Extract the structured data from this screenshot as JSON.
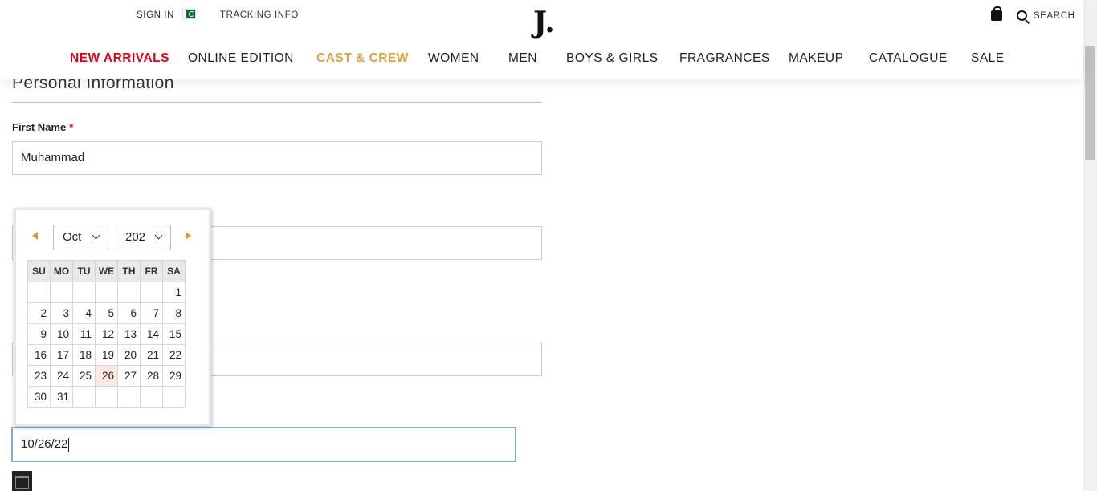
{
  "header": {
    "sign_in": "SIGN IN",
    "tracking": "TRACKING INFO",
    "logo": "J.",
    "search": "SEARCH"
  },
  "nav": [
    {
      "label": "NEW ARRIVALS",
      "color": "#e0001b"
    },
    {
      "label": "ONLINE EDITION",
      "color": "#222222"
    },
    {
      "label": "CAST & CREW",
      "color": "#d9a441"
    },
    {
      "label": "WOMEN",
      "color": "#222222"
    },
    {
      "label": "MEN",
      "color": "#222222"
    },
    {
      "label": "BOYS & GIRLS",
      "color": "#222222"
    },
    {
      "label": "FRAGRANCES",
      "color": "#222222"
    },
    {
      "label": "MAKEUP",
      "color": "#222222"
    },
    {
      "label": "CATALOGUE",
      "color": "#222222"
    },
    {
      "label": "SALE",
      "color": "#222222"
    }
  ],
  "form": {
    "section_title": "Personal Information",
    "first_name_label": "First Name",
    "required_mark": "*",
    "first_name_value": "Muhammad",
    "last_name_value": "",
    "email_value": "",
    "dob_value": "10/26/22"
  },
  "datepicker": {
    "month": "Oct",
    "year": "202",
    "weekdays": [
      "SU",
      "MO",
      "TU",
      "WE",
      "TH",
      "FR",
      "SA"
    ],
    "weeks": [
      [
        "",
        "",
        "",
        "",
        "",
        "",
        "1"
      ],
      [
        "2",
        "3",
        "4",
        "5",
        "6",
        "7",
        "8"
      ],
      [
        "9",
        "10",
        "11",
        "12",
        "13",
        "14",
        "15"
      ],
      [
        "16",
        "17",
        "18",
        "19",
        "20",
        "21",
        "22"
      ],
      [
        "23",
        "24",
        "25",
        "26",
        "27",
        "28",
        "29"
      ],
      [
        "30",
        "31",
        "",
        "",
        "",
        "",
        ""
      ]
    ],
    "today": "26",
    "accent": "#e8962c"
  }
}
